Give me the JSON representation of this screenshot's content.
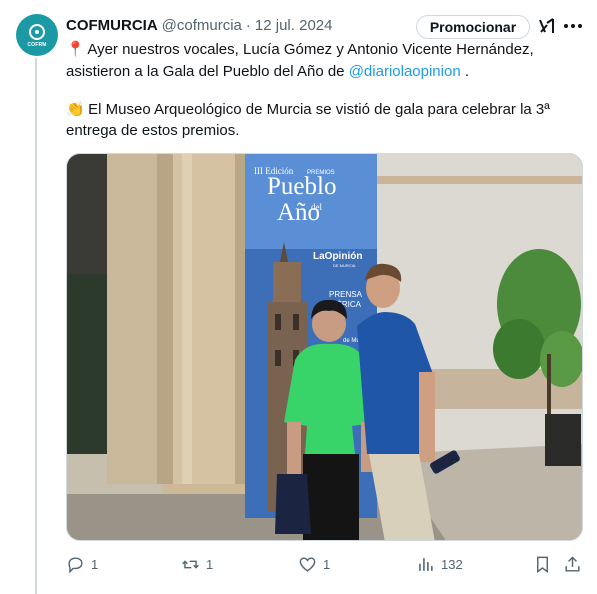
{
  "tweet": {
    "author_name": "COFMURCIA",
    "handle": "@cofmurcia",
    "separator": "·",
    "date": "12 jul. 2024",
    "avatar_text": "COFRM",
    "promote_label": "Promocionar",
    "line1_emoji": "📍",
    "line1": "Ayer nuestros vocales, Lucía Gómez y Antonio Vicente Hernández,",
    "line2_pre": "asistieron a la Gala del Pueblo del Año de ",
    "line2_mention": "@diariolaopinion",
    "line2_post": " .",
    "line3_emoji": "👏",
    "line3": "El Museo Arqueológico de Murcia se vistió de gala para celebrar la 3ª",
    "line4": "entrega de estos premios."
  },
  "banner": {
    "edition": "III Edición",
    "premios": "PREMIOS",
    "title1": "Pueblo",
    "title_del": "del",
    "title2": "Año",
    "sponsor1": "LaOpinión",
    "sponsor1_sub": "DE MURCIA",
    "sponsor2_line1": "PRENSA",
    "sponsor2_line2": "IBÉRICA",
    "footer": "de Murcia"
  },
  "actions": {
    "replies": "1",
    "reposts": "1",
    "likes": "1",
    "views": "132"
  },
  "colors": {
    "accent": "#1d9bf0",
    "muted": "#536471",
    "avatar": "#1b9aa6"
  }
}
